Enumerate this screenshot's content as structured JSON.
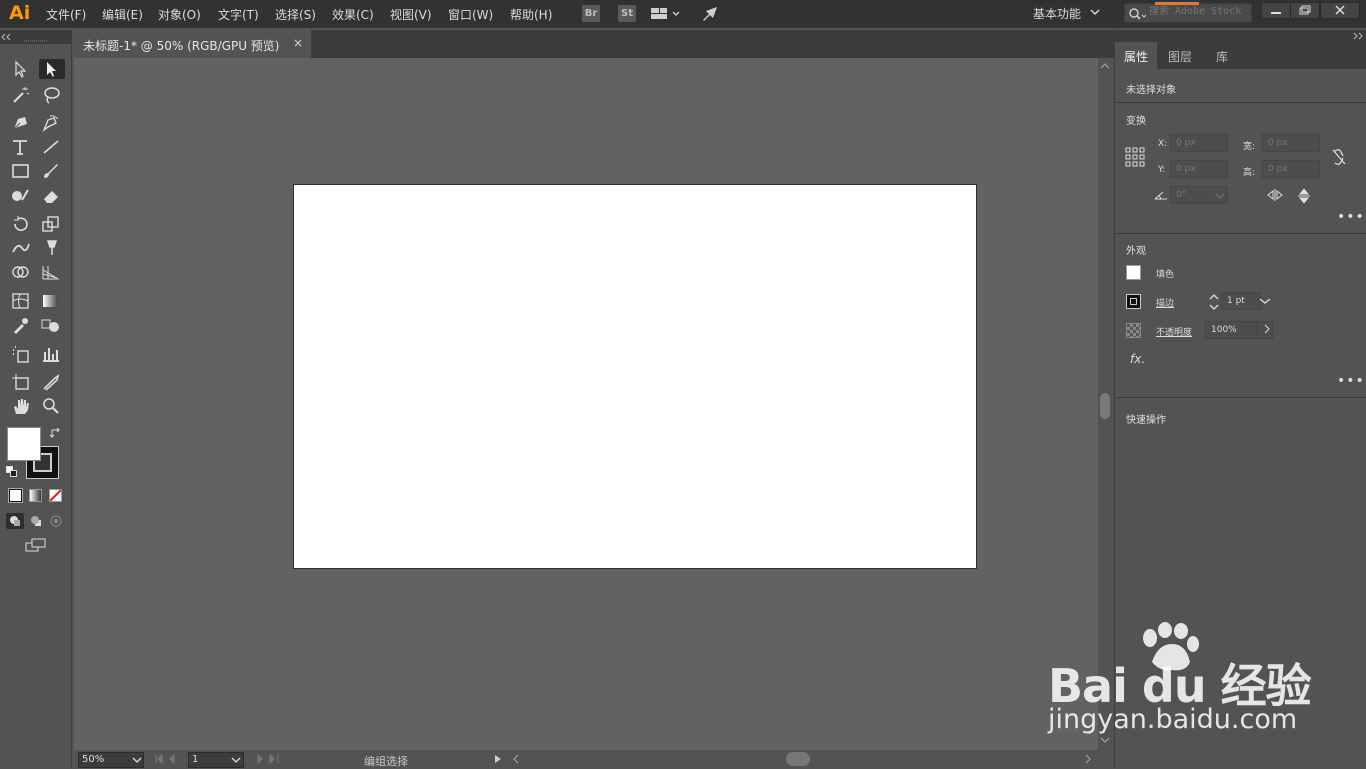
{
  "app": {
    "logo": "Ai"
  },
  "menu": [
    "文件(F)",
    "编辑(E)",
    "对象(O)",
    "文字(T)",
    "选择(S)",
    "效果(C)",
    "视图(V)",
    "窗口(W)",
    "帮助(H)"
  ],
  "menubar_buttons": {
    "bridge": "Br",
    "stock": "St"
  },
  "workspace": "基本功能",
  "search": {
    "placeholder": "搜索 Adobe Stock"
  },
  "document_tab": {
    "title": "未标题-1* @ 50% (RGB/GPU 预览)",
    "close": "×"
  },
  "statusbar": {
    "zoom": "50%",
    "page": "1",
    "status": "编组选择"
  },
  "panel": {
    "tabs": [
      "属性",
      "图层",
      "库"
    ],
    "active_tab": "属性",
    "no_selection": "未选择对象",
    "transform": {
      "title": "变换",
      "x_label": "X:",
      "x_value": "0 px",
      "y_label": "Y:",
      "y_value": "0 px",
      "w_label": "宽:",
      "w_value": "0 px",
      "h_label": "高:",
      "h_value": "0 px",
      "angle_value": "0°"
    },
    "appearance": {
      "title": "外观",
      "fill_label": "填色",
      "stroke_label": "描边",
      "stroke_value": "1 pt",
      "opacity_label": "不透明度",
      "opacity_value": "100%",
      "fx_label": "fx."
    },
    "quick_actions": {
      "title": "快速操作"
    }
  },
  "watermark": {
    "brand": "Bai du 经验",
    "url": "jingyan.baidu.com"
  },
  "colors": {
    "accent": "#ff9a00",
    "canvas": "#626262",
    "chrome": "#535353",
    "artboard": "#ffffff"
  }
}
